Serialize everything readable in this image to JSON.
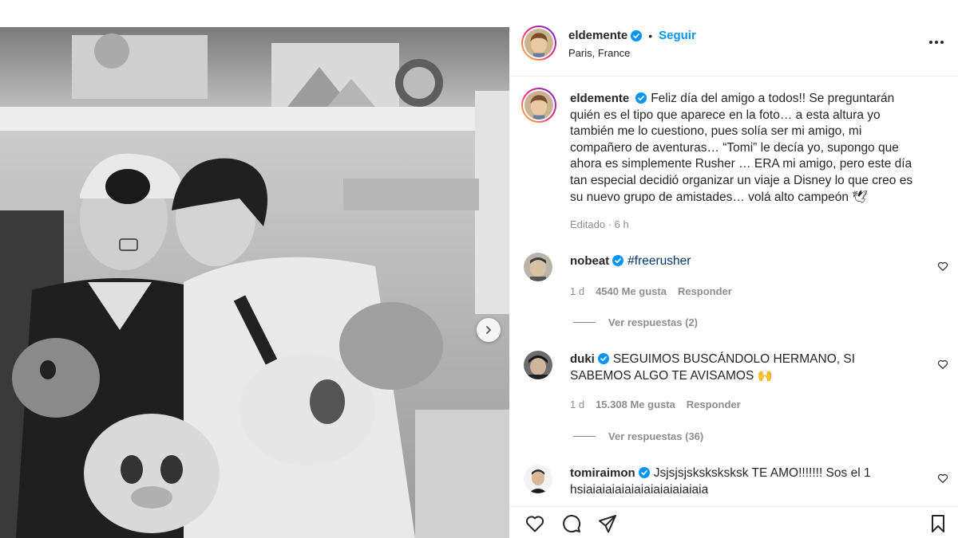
{
  "post": {
    "username": "eldemente",
    "location": "Paris, France",
    "follow_label": "Seguir",
    "dot": "•",
    "caption": "Feliz día del amigo a todos!! Se preguntarán quién es el tipo que aparece en la foto… a esta altura yo también me lo cuestiono, pues solía ser mi amigo, mi compañero de aventuras… “Tomi” le decía yo, supongo que ahora es simplemente Rusher … ERA mi amigo, pero este día tan especial decidió organizar un viaje a Disney lo que creo es su nuevo grupo de amistades… volá alto campeón 🕊",
    "edited_label": "Editado · 6 h"
  },
  "comments": [
    {
      "username": "nobeat",
      "text": "#freerusher",
      "age": "1 d",
      "likes": "4540 Me gusta",
      "reply_label": "Responder",
      "view_replies": "Ver respuestas (2)"
    },
    {
      "username": "duki",
      "text": "SEGUIMOS BUSCÁNDOLO HERMANO, SI SABEMOS ALGO TE AVISAMOS 🙌",
      "age": "1 d",
      "likes": "15.308 Me gusta",
      "reply_label": "Responder",
      "view_replies": "Ver respuestas (36)"
    },
    {
      "username": "tomiraimon",
      "text": "Jsjsjsjsksksksksk TE AMO!!!!!!! Sos el 1 hsiaiaiaiaiaiaiaiaiaiaiaiaia"
    }
  ],
  "icons": {
    "verified": "verified-badge-icon",
    "more": "more-options-icon",
    "like": "heart-icon",
    "comment": "comment-icon",
    "share": "share-icon",
    "save": "bookmark-icon",
    "next": "chevron-right-icon"
  },
  "colors": {
    "accent": "#0095f6",
    "verified": "#0095f6",
    "muted": "#8e8e8e",
    "text": "#262626"
  }
}
